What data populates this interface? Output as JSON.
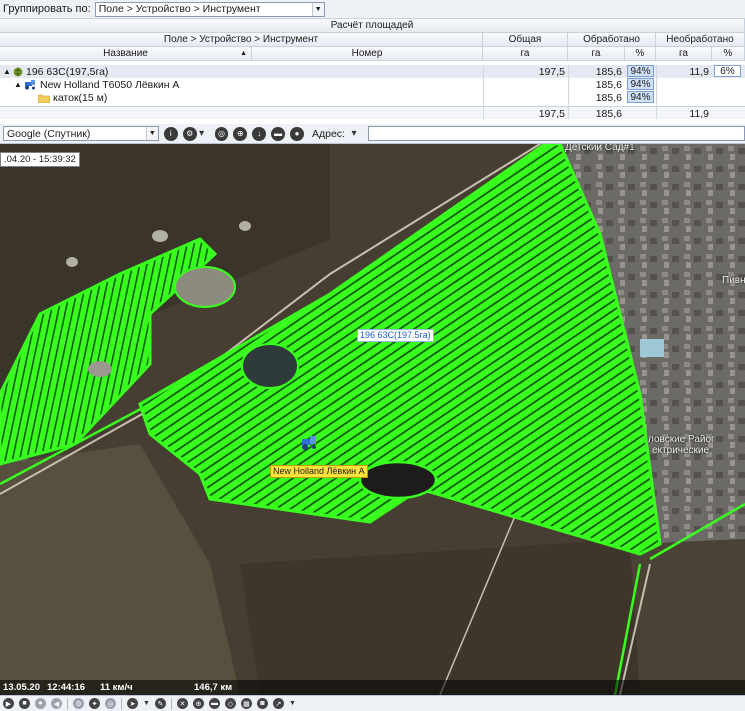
{
  "groupbar": {
    "label": "Группировать по:",
    "value": "Поле > Устройство > Инструмент"
  },
  "table": {
    "title": "Расчёт площадей",
    "headers": {
      "group": "Поле > Устройство > Инструмент",
      "total": "Общая",
      "processed": "Обработано",
      "unprocessed": "Необработано",
      "name": "Название",
      "number": "Номер",
      "ha1": "га",
      "ha2": "га",
      "pct1": "%",
      "ha3": "га",
      "pct2": "%"
    },
    "rows": [
      {
        "name": "196 63С(197,5га)",
        "total": "197,5",
        "processed": "185,6",
        "processed_pct": "94%",
        "unprocessed": "11,9",
        "unprocessed_pct": "6%"
      },
      {
        "name": "New Holland T6050 Лёвкин А",
        "processed": "185,6",
        "processed_pct": "94%"
      },
      {
        "name": "каток(15 м)",
        "processed": "185,6",
        "processed_pct": "94%"
      }
    ],
    "totals": {
      "total": "197,5",
      "processed": "185,6",
      "unprocessed": "11,9"
    }
  },
  "maptoolbar": {
    "source": "Google (Спутник)",
    "address_label": "Адрес:",
    "address_value": ""
  },
  "map": {
    "timestamp": ".04.20 - 15:39:32",
    "field_label": "196 63С(197.5га)",
    "device_label": "New Holland Лёвкин А",
    "place1": "Детский Сад#1",
    "place2": "ловские Райог",
    "place3": "ектрические",
    "place4": "Пивн",
    "status": {
      "date": "13.05.20",
      "time": "12:44:16",
      "speed": "11 км/ч",
      "distance": "146,7 км"
    }
  },
  "colors": {
    "track": "#39ff1e",
    "header_bg": "#e6eaf1",
    "selected_row": "#e4e9f2"
  }
}
